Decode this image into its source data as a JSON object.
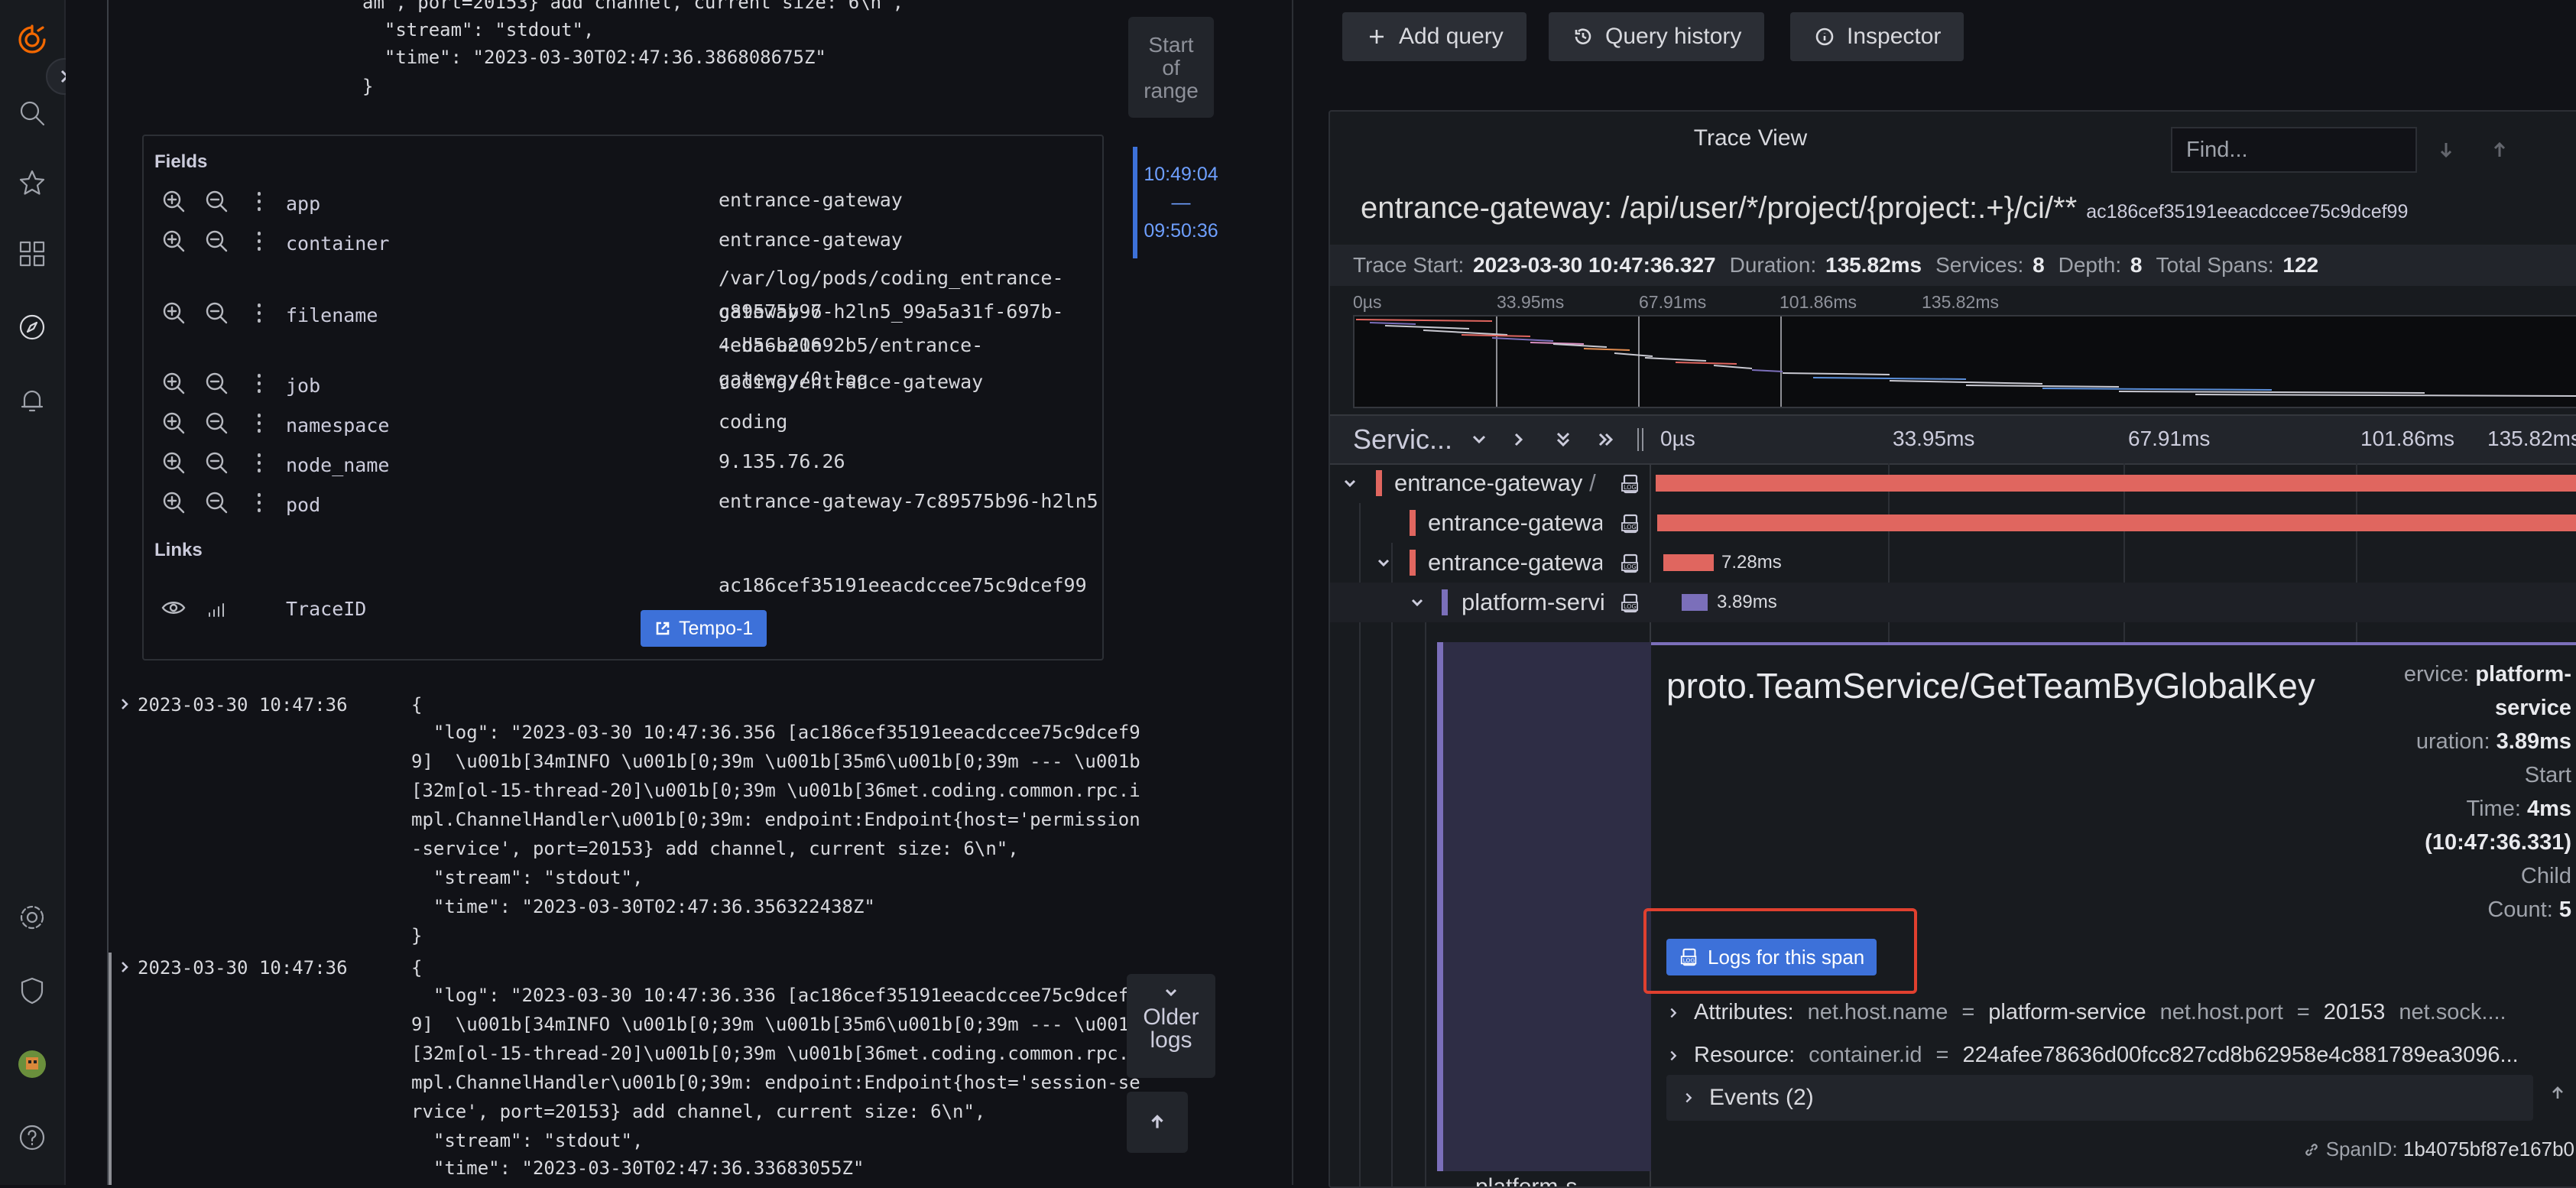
{
  "logs": {
    "top_fragment": [
      "am', port=20153} add channel, current size: 6\\n\",",
      "  \"stream\": \"stdout\",",
      "  \"time\": \"2023-03-30T02:47:36.386808675Z\"",
      "}"
    ],
    "fields_title": "Fields",
    "fields": [
      {
        "key": "app",
        "value": "entrance-gateway"
      },
      {
        "key": "container",
        "value": "entrance-gateway"
      },
      {
        "key": "filename",
        "value_lines": [
          "/var/log/pods/coding_entrance-gateway-7",
          "c89575b96-h2ln5_99a5a31f-697b-4eda-b21e",
          "-eb56ae0692b5/entrance-gateway/0.log"
        ]
      },
      {
        "key": "job",
        "value": "coding/entrance-gateway"
      },
      {
        "key": "namespace",
        "value": "coding"
      },
      {
        "key": "node_name",
        "value": "9.135.76.26"
      },
      {
        "key": "pod",
        "value": "entrance-gateway-7c89575b96-h2ln5"
      }
    ],
    "links_title": "Links",
    "link": {
      "key": "TraceID",
      "value": "ac186cef35191eeacdccee75c9dcef99",
      "button": "Tempo-1"
    },
    "entries": [
      {
        "ts": "2023-03-30 10:47:36",
        "lines": [
          "  \"log\": \"2023-03-30 10:47:36.356 [ac186cef35191eeacdccee75c9dcef9",
          "9]  \\u001b[34mINFO \\u001b[0;39m \\u001b[35m6\\u001b[0;39m --- \\u001b",
          "[32m[ol-15-thread-20]\\u001b[0;39m \\u001b[36met.coding.common.rpc.i",
          "mpl.ChannelHandler\\u001b[0;39m: endpoint:Endpoint{host='permission",
          "-service', port=20153} add channel, current size: 6\\n\",",
          "  \"stream\": \"stdout\",",
          "  \"time\": \"2023-03-30T02:47:36.356322438Z\"",
          "}"
        ]
      },
      {
        "ts": "2023-03-30 10:47:36",
        "lines": [
          "  \"log\": \"2023-03-30 10:47:36.336 [ac186cef35191eeacdccee75c9dcef9",
          "9]  \\u001b[34mINFO \\u001b[0;39m \\u001b[35m6\\u001b[0;39m --- \\u001b",
          "[32m[ol-15-thread-20]\\u001b[0;39m \\u001b[36met.coding.common.rpc.i",
          "mpl.ChannelHandler\\u001b[0;39m: endpoint:Endpoint{host='session-se",
          "rvice', port=20153} add channel, current size: 6\\n\",",
          "  \"stream\": \"stdout\",",
          "  \"time\": \"2023-03-30T02:47:36.33683055Z\""
        ]
      }
    ],
    "range": {
      "start_label": [
        "Start",
        "of",
        "range"
      ],
      "time_top": "10:49:04",
      "dash": "—",
      "time_bottom": "09:50:36",
      "older_label": [
        "Older",
        "logs"
      ]
    }
  },
  "toolbar": {
    "add_query": "Add query",
    "query_history": "Query history",
    "inspector": "Inspector"
  },
  "trace": {
    "view_title": "Trace View",
    "find_placeholder": "Find...",
    "title": "entrance-gateway: /api/user/*/project/{project:.+}/ci/**",
    "trace_id": "ac186cef35191eeacdccee75c9dcef99",
    "stats": {
      "start_label": "Trace Start:",
      "start": "2023-03-30 10:47:36.327",
      "duration_label": "Duration:",
      "duration": "135.82ms",
      "services_label": "Services:",
      "services": "8",
      "depth_label": "Depth:",
      "depth": "8",
      "spans_label": "Total Spans:",
      "spans": "122"
    },
    "minimap_ticks": [
      "0µs",
      "33.95ms",
      "67.91ms",
      "101.86ms",
      "135.82ms"
    ],
    "header": {
      "service_col": "Servic...",
      "ticks": [
        "0µs",
        "33.95ms",
        "67.91ms",
        "101.86ms",
        "135.82ms"
      ]
    },
    "rows": [
      {
        "name": "entrance-gateway",
        "suffix": "/",
        "color": "#e0665f",
        "bar_label": ""
      },
      {
        "name": "entrance-gateway",
        "suffix": "",
        "color": "#e0665f",
        "bar_label": ""
      },
      {
        "name": "entrance-gateway",
        "suffix": "",
        "color": "#e0665f",
        "bar_label": "7.28ms"
      },
      {
        "name": "platform-service",
        "suffix": "",
        "color": "#7b6fba",
        "bar_label": "3.89ms"
      }
    ],
    "detail": {
      "operation": "proto.TeamService/GetTeamByGlobalKey",
      "service_label": "ervice:",
      "service_value": "platform-",
      "service_value2": "service",
      "duration_label": "uration:",
      "duration_value": "3.89ms",
      "start_label": "Start",
      "time_label": "Time:",
      "time_value": "4ms",
      "time_abs": "(10:47:36.331)",
      "child_label": "Child",
      "count_label": "Count:",
      "count_value": "5",
      "logs_button": "Logs for this span",
      "attributes_label": "Attributes:",
      "attr1_k": "net.host.name",
      "attr1_v": "platform-service",
      "attr2_k": "net.host.port",
      "attr2_v": "20153",
      "attr3": "net.sock....",
      "resource_label": "Resource:",
      "res1_k": "container.id",
      "res1_v": "224afee78636d00fcc827cd8b62958e4c881789ea3096...",
      "events": "Events (2)",
      "spanid_label": "SpanID:",
      "spanid": "1b4075bf87e167b0"
    },
    "next_row": "platform-s"
  },
  "colors": {
    "accent": "#3d71d9",
    "span_red": "#e0665f",
    "span_purple": "#7b6fba",
    "highlight": "#e0402f"
  }
}
